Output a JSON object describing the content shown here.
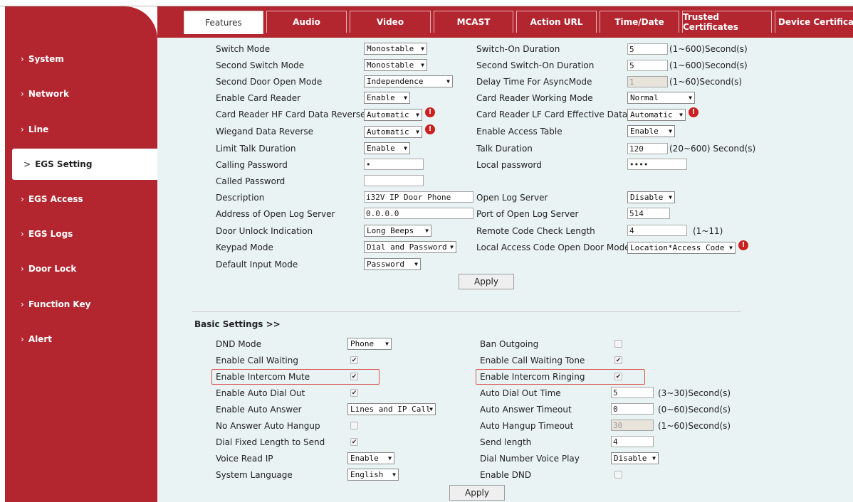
{
  "sidebar": {
    "items": [
      {
        "label": "System"
      },
      {
        "label": "Network"
      },
      {
        "label": "Line"
      },
      {
        "label": "EGS Setting"
      },
      {
        "label": "EGS Access"
      },
      {
        "label": "EGS Logs"
      },
      {
        "label": "Door Lock"
      },
      {
        "label": "Function Key"
      },
      {
        "label": "Alert"
      }
    ],
    "arrow": "›",
    "active_arrow": ">"
  },
  "tabs": [
    {
      "label": "Features"
    },
    {
      "label": "Audio"
    },
    {
      "label": "Video"
    },
    {
      "label": "MCAST"
    },
    {
      "label": "Action URL"
    },
    {
      "label": "Time/Date"
    },
    {
      "label": "Trusted Certificates"
    },
    {
      "label": "Device Certificate"
    }
  ],
  "features": {
    "switch_mode": {
      "label": "Switch Mode",
      "value": "Monostable"
    },
    "switch_on_duration": {
      "label": "Switch-On Duration",
      "value": "5",
      "hint": "(1~600)Second(s)"
    },
    "second_switch_mode": {
      "label": "Second Switch Mode",
      "value": "Monostable"
    },
    "second_switch_on_duration": {
      "label": "Second Switch-On Duration",
      "value": "5",
      "hint": "(1~600)Second(s)"
    },
    "second_door_open_mode": {
      "label": "Second Door Open Mode",
      "value": "Independence"
    },
    "delay_time_async": {
      "label": "Delay Time For AsyncMode",
      "value": "1",
      "hint": "(1~60)Second(s)"
    },
    "enable_card_reader": {
      "label": "Enable Card Reader",
      "value": "Enable"
    },
    "card_reader_working_mode": {
      "label": "Card Reader Working Mode",
      "value": "Normal"
    },
    "card_reader_hf_reverse": {
      "label": "Card Reader HF Card Data Reverse",
      "value": "Automatic"
    },
    "card_reader_lf_effective": {
      "label": "Card Reader LF Card Effective Data",
      "value": "Automatic"
    },
    "wiegand_data_reverse": {
      "label": "Wiegand Data Reverse",
      "value": "Automatic"
    },
    "enable_access_table": {
      "label": "Enable Access Table",
      "value": "Enable"
    },
    "limit_talk_duration": {
      "label": "Limit Talk Duration",
      "value": "Enable"
    },
    "talk_duration": {
      "label": "Talk Duration",
      "value": "120",
      "hint": "(20~600) Second(s)"
    },
    "calling_password": {
      "label": "Calling Password",
      "value": "•"
    },
    "local_password": {
      "label": "Local password",
      "value": "••••"
    },
    "called_password": {
      "label": "Called Password",
      "value": ""
    },
    "description": {
      "label": "Description",
      "value": "i32V IP Door Phone"
    },
    "open_log_server": {
      "label": "Open Log Server",
      "value": "Disable"
    },
    "open_log_server_address": {
      "label": "Address of Open Log Server",
      "value": "0.0.0.0"
    },
    "open_log_server_port": {
      "label": "Port of Open Log Server",
      "value": "514"
    },
    "door_unlock_indication": {
      "label": "Door Unlock Indication",
      "value": "Long Beeps"
    },
    "remote_code_check_length": {
      "label": "Remote Code Check Length",
      "value": "4",
      "hint": "(1~11)"
    },
    "keypad_mode": {
      "label": "Keypad Mode",
      "value": "Dial and Password"
    },
    "local_access_code_mode": {
      "label": "Local Access Code Open Door Mode",
      "value": "Location*Access Code"
    },
    "default_input_mode": {
      "label": "Default Input Mode",
      "value": "Password"
    },
    "apply_label": "Apply",
    "warn_glyph": "!"
  },
  "basic": {
    "title": "Basic Settings >>",
    "dnd_mode": {
      "label": "DND Mode",
      "value": "Phone"
    },
    "ban_outgoing": {
      "label": "Ban Outgoing",
      "checked": false
    },
    "enable_call_waiting": {
      "label": "Enable Call Waiting",
      "checked": true
    },
    "enable_call_waiting_tone": {
      "label": "Enable Call Waiting Tone",
      "checked": true
    },
    "enable_intercom_mute": {
      "label": "Enable Intercom Mute",
      "checked": true
    },
    "enable_intercom_ringing": {
      "label": "Enable Intercom Ringing",
      "checked": true
    },
    "enable_auto_dial_out": {
      "label": "Enable Auto Dial Out",
      "checked": true
    },
    "auto_dial_out_time": {
      "label": "Auto Dial Out Time",
      "value": "5",
      "hint": "(3~30)Second(s)"
    },
    "enable_auto_answer": {
      "label": "Enable Auto Answer",
      "value": "Lines and IP Call"
    },
    "auto_answer_timeout": {
      "label": "Auto Answer Timeout",
      "value": "0",
      "hint": "(0~60)Second(s)"
    },
    "no_answer_auto_hangup": {
      "label": "No Answer Auto Hangup",
      "checked": false
    },
    "auto_hangup_timeout": {
      "label": "Auto Hangup Timeout",
      "value": "30",
      "hint": "(1~60)Second(s)"
    },
    "dial_fixed_length": {
      "label": "Dial Fixed Length to Send",
      "checked": true
    },
    "send_length": {
      "label": "Send length",
      "value": "4"
    },
    "voice_read_ip": {
      "label": "Voice Read IP",
      "value": "Enable"
    },
    "dial_number_voice_play": {
      "label": "Dial Number Voice Play",
      "value": "Disable"
    },
    "system_language": {
      "label": "System Language",
      "value": "English"
    },
    "enable_dnd": {
      "label": "Enable DND",
      "checked": false
    },
    "apply_label": "Apply",
    "check_glyph": "✔",
    "dd_glyph": "▼"
  }
}
